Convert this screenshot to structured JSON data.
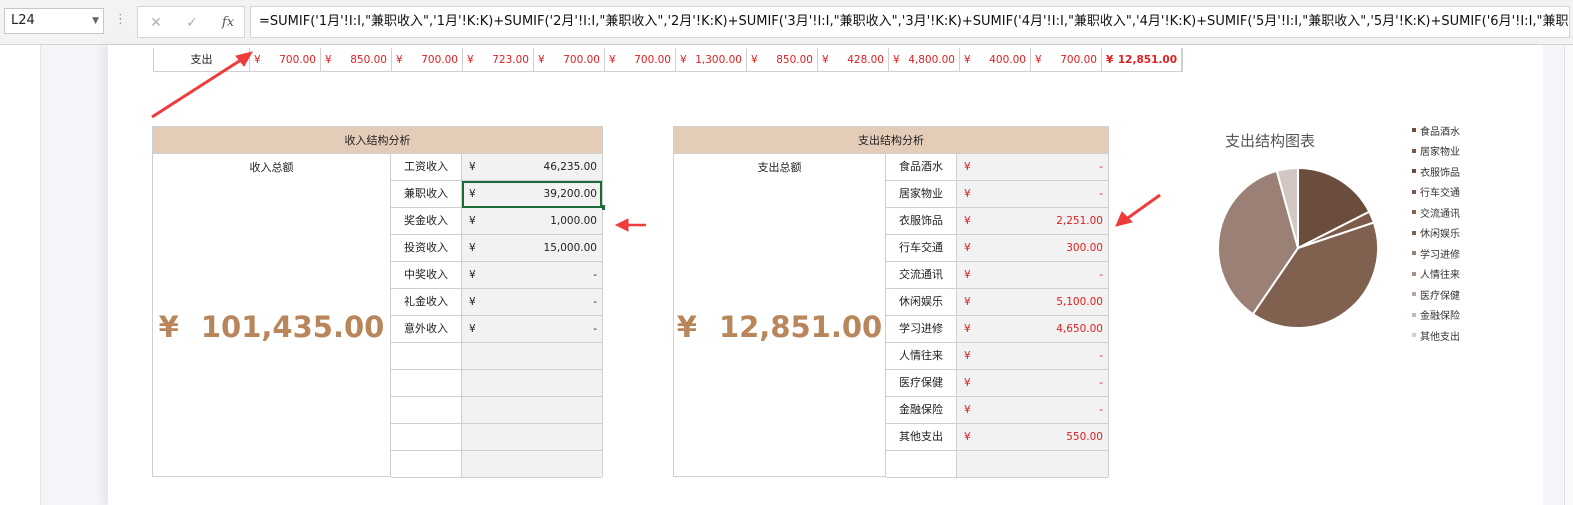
{
  "formula_bar": {
    "cell_ref": "L24",
    "formula": "=SUMIF('1月'!I:I,\"兼职收入\",'1月'!K:K)+SUMIF('2月'!I:I,\"兼职收入\",'2月'!K:K)+SUMIF('3月'!I:I,\"兼职收入\",'3月'!K:K)+SUMIF('4月'!I:I,\"兼职收入\",'4月'!K:K)+SUMIF('5月'!I:I,\"兼职收入\",'5月'!K:K)+SUMIF('6月'!I:I,\"兼职"
  },
  "expense_row": {
    "label": "支出",
    "currency": "¥",
    "values": [
      "700.00",
      "850.00",
      "700.00",
      "723.00",
      "700.00",
      "700.00",
      "1,300.00",
      "850.00",
      "428.00",
      "4,800.00",
      "400.00",
      "700.00"
    ],
    "total": "12,851.00"
  },
  "income": {
    "header": "收入结构分析",
    "total_label": "收入总额",
    "currency": "¥",
    "total_amount": "101,435.00",
    "rows": [
      {
        "category": "工资收入",
        "amount": "46,235.00"
      },
      {
        "category": "兼职收入",
        "amount": "39,200.00"
      },
      {
        "category": "奖金收入",
        "amount": "1,000.00"
      },
      {
        "category": "投资收入",
        "amount": "15,000.00"
      },
      {
        "category": "中奖收入",
        "amount": "-"
      },
      {
        "category": "礼金收入",
        "amount": "-"
      },
      {
        "category": "意外收入",
        "amount": "-"
      }
    ]
  },
  "expense": {
    "header": "支出结构分析",
    "total_label": "支出总额",
    "currency": "¥",
    "total_amount": "12,851.00",
    "rows": [
      {
        "category": "食品酒水",
        "amount": "-"
      },
      {
        "category": "居家物业",
        "amount": "-"
      },
      {
        "category": "衣服饰品",
        "amount": "2,251.00"
      },
      {
        "category": "行车交通",
        "amount": "300.00"
      },
      {
        "category": "交流通讯",
        "amount": "-"
      },
      {
        "category": "休闲娱乐",
        "amount": "5,100.00"
      },
      {
        "category": "学习进修",
        "amount": "4,650.00"
      },
      {
        "category": "人情往来",
        "amount": "-"
      },
      {
        "category": "医疗保健",
        "amount": "-"
      },
      {
        "category": "金融保险",
        "amount": "-"
      },
      {
        "category": "其他支出",
        "amount": "550.00"
      }
    ]
  },
  "chart_data": {
    "type": "pie",
    "title": "支出结构图表",
    "categories": [
      "食品酒水",
      "居家物业",
      "衣服饰品",
      "行车交通",
      "交流通讯",
      "休闲娱乐",
      "学习进修",
      "人情往来",
      "医疗保健",
      "金融保险",
      "其他支出"
    ],
    "values": [
      0,
      0,
      2251,
      300,
      0,
      5100,
      4650,
      0,
      0,
      0,
      550
    ],
    "colors": [
      "#6e4c3a",
      "#7a5544",
      "#6b4d3e",
      "#7d5a4a",
      "#86614f",
      "#80604f",
      "#9a8075",
      "#a88f84",
      "#b8a69d",
      "#c8b9b2",
      "#d7ccc7"
    ],
    "slice_colors": [
      "#6b4d3e",
      "#7d5a4a",
      "#80604f",
      "#9a8075",
      "#d2c7c2"
    ],
    "legend": "right"
  }
}
